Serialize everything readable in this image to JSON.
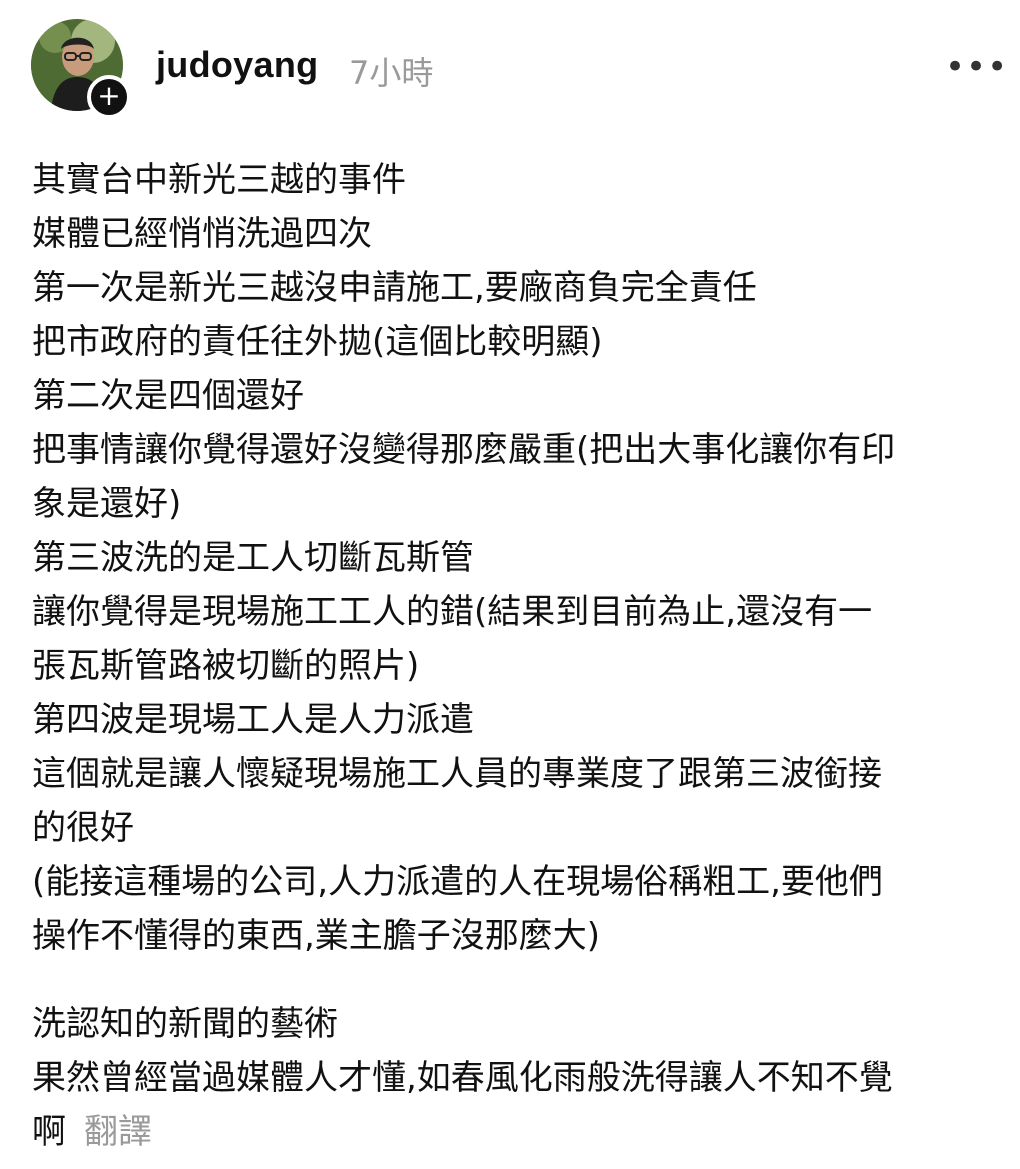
{
  "post": {
    "username": "judoyang",
    "time": "7小時",
    "follow_symbol": "+",
    "more_symbol": "•••",
    "paragraphs": [
      "其實台中新光三越的事件\n媒體已經悄悄洗過四次\n第一次是新光三越沒申請施工,要廠商負完全責任\n把市政府的責任往外拋(這個比較明顯)\n第二次是四個還好\n把事情讓你覺得還好沒變得那麼嚴重(把出大事化讓你有印\n象是還好)\n第三波洗的是工人切斷瓦斯管\n讓你覺得是現場施工工人的錯(結果到目前為止,還沒有一\n張瓦斯管路被切斷的照片)\n第四波是現場工人是人力派遣\n這個就是讓人懷疑現場施工人員的專業度了跟第三波銜接\n的很好\n(能接這種場的公司,人力派遣的人在現場俗稱粗工,要他們\n操作不懂得的東西,業主膽子沒那麼大)",
      "洗認知的新聞的藝術\n果然曾經當過媒體人才懂,如春風化雨般洗得讓人不知不覺\n啊"
    ],
    "translate_label": "翻譯"
  },
  "icons": {
    "avatar": "profile-photo",
    "follow": "plus-icon",
    "more": "more-icon"
  },
  "colors": {
    "text": "#111111",
    "muted": "#9a9a9a",
    "badge": "#111111"
  }
}
